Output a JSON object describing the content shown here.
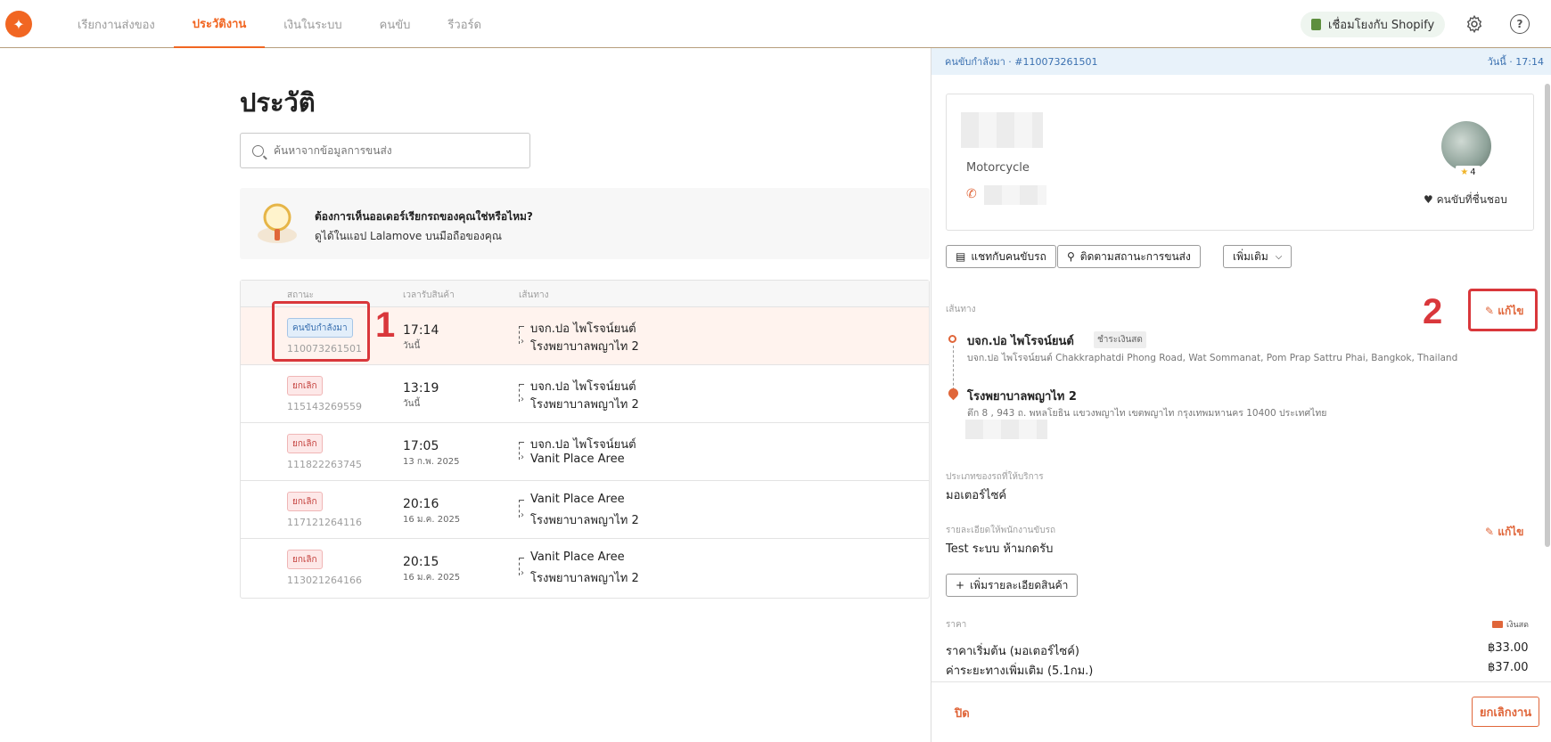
{
  "nav": {
    "items": [
      "เรียกงานส่งของ",
      "ประวัติงาน",
      "เงินในระบบ",
      "คนขับ",
      "รีวอร์ด"
    ],
    "shopify_label": "เชื่อมโยงกับ Shopify",
    "help": "?"
  },
  "page": {
    "title": "ประวัติ",
    "search_placeholder": "ค้นหาจากข้อมูลการขนส่ง"
  },
  "promo": {
    "title": "ต้องการเห็นออเดอร์เรียกรถของคุณใช่หรือไหม?",
    "subtitle": "ดูได้ในแอป Lalamove บนมือถือของคุณ"
  },
  "table": {
    "headers": [
      "สถานะ",
      "เวลารับสินค้า",
      "เส้นทาง"
    ],
    "rows": [
      {
        "status": "คนขับกำลังมา",
        "id": "110073261501",
        "time": "17:14",
        "date": "วันนี้",
        "from": "บจก.ปอ ไพโรจน์ยนต์",
        "to": "โรงพยาบาลพญาไท 2"
      },
      {
        "status": "ยกเลิก",
        "id": "115143269559",
        "time": "13:19",
        "date": "วันนี้",
        "from": "บจก.ปอ ไพโรจน์ยนต์",
        "to": "โรงพยาบาลพญาไท 2"
      },
      {
        "status": "ยกเลิก",
        "id": "111822263745",
        "time": "17:05",
        "date": "13 ก.พ. 2025",
        "from": "บจก.ปอ ไพโรจน์ยนต์",
        "to": "Vanit Place Aree"
      },
      {
        "status": "ยกเลิก",
        "id": "117121264116",
        "time": "20:16",
        "date": "16 ม.ค. 2025",
        "from": "Vanit Place Aree",
        "to": "โรงพยาบาลพญาไท 2"
      },
      {
        "status": "ยกเลิก",
        "id": "113021264166",
        "time": "20:15",
        "date": "16 ม.ค. 2025",
        "from": "Vanit Place Aree",
        "to": "โรงพยาบาลพญาไท 2"
      }
    ]
  },
  "annotations": {
    "one": "1",
    "two": "2"
  },
  "panel": {
    "header_left": "คนขับกำลังมา · #110073261501",
    "header_right": "วันนี้ · 17:14",
    "vehicle": "Motorcycle",
    "rating": "4",
    "fav_label": "คนขับที่ชื่นชอบ",
    "buttons": {
      "chat": "แชทกับคนขับรถ",
      "track": "ติดตามสถานะการขนส่ง",
      "more": "เพิ่มเติม"
    },
    "route_label": "เส้นทาง",
    "edit_label": "แก้ไข",
    "stop1_name": "บจก.ปอ ไพโรจน์ยนต์",
    "stop1_tag": "ชำระเงินสด",
    "stop1_addr": "บจก.ปอ ไพโรจน์ยนต์ Chakkraphatdi Phong Road, Wat Sommanat, Pom Prap Sattru Phai, Bangkok, Thailand",
    "stop2_name": "โรงพยาบาลพญาไท 2",
    "stop2_addr": "ตึก 8 , 943 ถ. พหลโยธิน แขวงพญาไท เขตพญาไท กรุงเทพมหานคร 10400 ประเทศไทย",
    "vehicle_type_label": "ประเภทของรถที่ให้บริการ",
    "vehicle_type": "มอเตอร์ไซค์",
    "notes_label": "รายละเอียดให้พนักงานขับรถ",
    "notes": "Test ระบบ ห้ามกดรับ",
    "add_item_details": "เพิ่มรายละเอียดสินค้า",
    "price_label": "ราคา",
    "payment": "เงินสด",
    "price_items": [
      {
        "label": "ราคาเริ่มต้น (มอเตอร์ไซค์)",
        "value": "฿33.00"
      },
      {
        "label": "ค่าระยะทางเพิ่มเติม (5.1กม.)",
        "value": "฿37.00"
      }
    ],
    "close": "ปิด",
    "cancel_job": "ยกเลิกงาน"
  }
}
